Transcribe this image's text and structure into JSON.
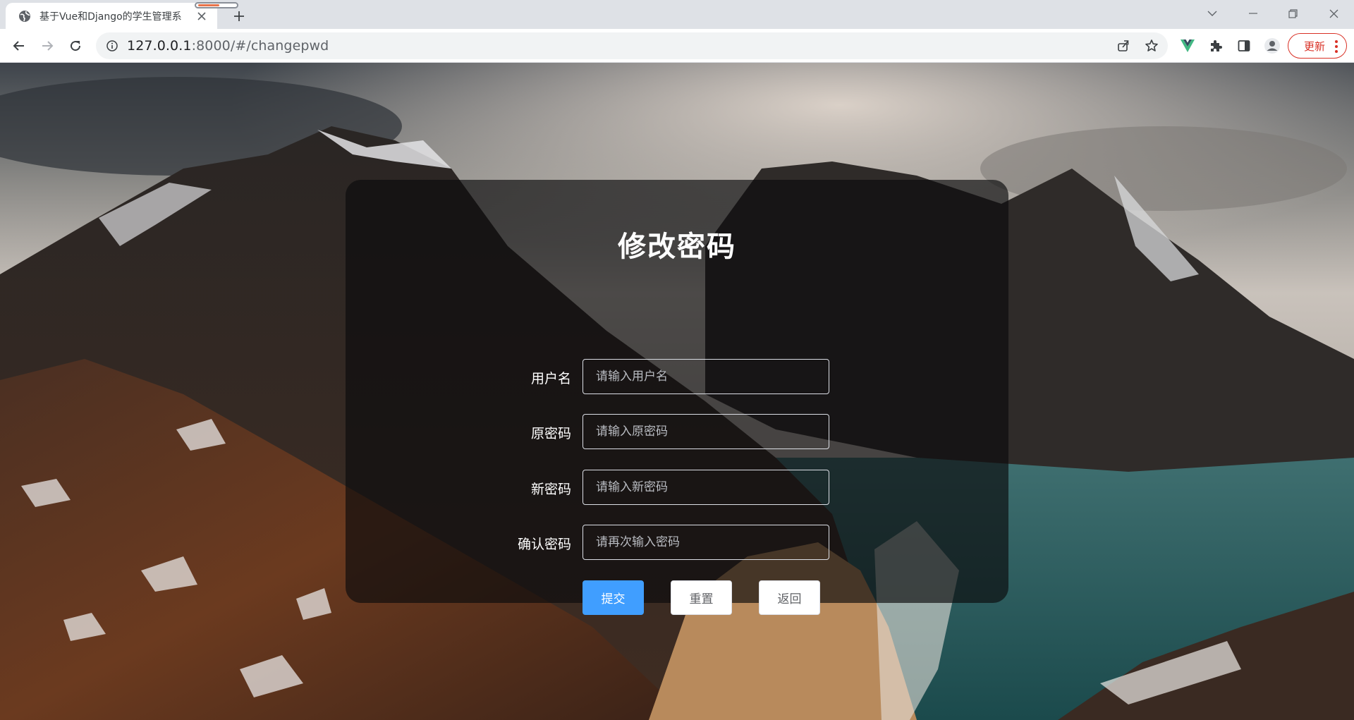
{
  "browser": {
    "tab_title": "基于Vue和Django的学生管理系",
    "url_host": "127.0.0.1",
    "url_rest": ":8000/#/changepwd",
    "update_label": "更新",
    "icons": {
      "favicon": "globe-icon",
      "tab_close": "close-icon",
      "new_tab": "plus-icon",
      "back": "arrow-left-icon",
      "forward": "arrow-right-icon",
      "reload": "reload-icon",
      "site_info": "info-icon",
      "share": "share-icon",
      "bookmark": "star-icon",
      "vue_devtools": "vue-icon",
      "extensions": "puzzle-icon",
      "side_panel": "side-panel-icon",
      "profile": "person-icon",
      "menu": "more-vert-icon"
    },
    "colors": {
      "tab_strip": "#dee1e6",
      "update_accent": "#d93025",
      "vue_green": "#42b883"
    }
  },
  "page": {
    "title": "修改密码",
    "fields": [
      {
        "label": "用户名",
        "placeholder": "请输入用户名",
        "value": ""
      },
      {
        "label": "原密码",
        "placeholder": "请输入原密码",
        "value": ""
      },
      {
        "label": "新密码",
        "placeholder": "请输入新密码",
        "value": ""
      },
      {
        "label": "确认密码",
        "placeholder": "请再次输入密码",
        "value": ""
      }
    ],
    "buttons": {
      "submit": "提交",
      "reset": "重置",
      "back": "返回"
    },
    "colors": {
      "primary": "#409eff",
      "panel_bg": "rgba(10,10,12,0.66)"
    }
  }
}
